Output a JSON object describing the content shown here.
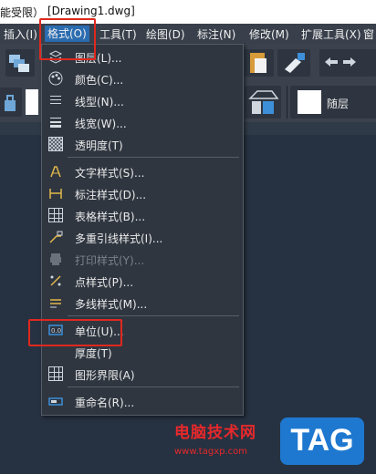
{
  "titlebar": {
    "left": "能受限）",
    "doc": "[Drawing1.dwg]"
  },
  "menubar": {
    "items": [
      {
        "label": "插入(I)"
      },
      {
        "label": "格式(O)"
      },
      {
        "label": "工具(T)"
      },
      {
        "label": "绘图(D)"
      },
      {
        "label": "标注(N)"
      },
      {
        "label": "修改(M)"
      },
      {
        "label": "扩展工具(X)"
      },
      {
        "label": "窗"
      }
    ]
  },
  "toolbar": {
    "layer_combo": "随层"
  },
  "format_menu": {
    "items": [
      {
        "label": "图层(L)...",
        "icon": "layers-icon"
      },
      {
        "label": "颜色(C)...",
        "icon": "palette-icon"
      },
      {
        "label": "线型(N)...",
        "icon": "linetype-icon"
      },
      {
        "label": "线宽(W)...",
        "icon": "lineweight-icon"
      },
      {
        "label": "透明度(T)",
        "icon": "transparency-icon"
      },
      {
        "label": "文字样式(S)...",
        "icon": "text-style-icon"
      },
      {
        "label": "标注样式(D)...",
        "icon": "dimension-style-icon"
      },
      {
        "label": "表格样式(B)...",
        "icon": "table-style-icon"
      },
      {
        "label": "多重引线样式(I)...",
        "icon": "multileader-style-icon"
      },
      {
        "label": "打印样式(Y)...",
        "icon": "plot-style-icon",
        "disabled": true
      },
      {
        "label": "点样式(P)...",
        "icon": "point-style-icon"
      },
      {
        "label": "多线样式(M)...",
        "icon": "multiline-style-icon"
      },
      {
        "label": "单位(U)...",
        "icon": "units-icon"
      },
      {
        "label": "厚度(T)",
        "icon": ""
      },
      {
        "label": "图形界限(A)",
        "icon": "limits-icon"
      },
      {
        "label": "重命名(R)...",
        "icon": "rename-icon"
      }
    ]
  },
  "watermark": {
    "title": "电脑技术网",
    "url": "www.tagxp.com",
    "tag": "TAG"
  },
  "colors": {
    "highlight": "#e0281e",
    "menu_active": "#2b6cb0",
    "watermark_red": "#e8282b",
    "watermark_blue": "#1e78d0"
  }
}
